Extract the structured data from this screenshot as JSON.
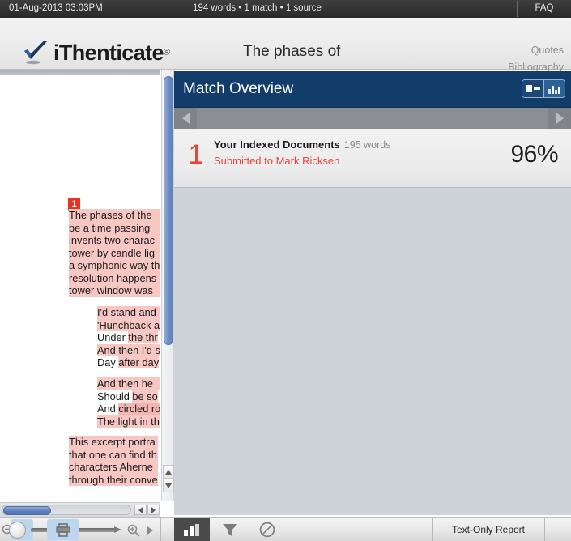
{
  "topbar": {
    "datetime": "01-Aug-2013 03:03PM",
    "stats": "194 words • 1 match • 1 source",
    "faq": "FAQ"
  },
  "header": {
    "logo_text": "iThenticate",
    "logo_registered": "®",
    "logo_icon": "blue-checkmark-icon",
    "document_title": "The phases of",
    "links": [
      {
        "label": "Quotes"
      },
      {
        "label": "Bibliography"
      }
    ]
  },
  "document": {
    "match_badge": "1",
    "paragraphs": [
      {
        "lines": [
          {
            "text": "The phases of the",
            "highlight": "full"
          },
          {
            "text": "be a time passing",
            "highlight": "full"
          },
          {
            "text": "invents two charac",
            "highlight": "full"
          },
          {
            "text": "tower by candle lig",
            "highlight": "full"
          },
          {
            "text": "a symphonic way th",
            "highlight": "full"
          },
          {
            "text": "resolution happens",
            "highlight": "full"
          },
          {
            "text": "tower window was",
            "highlight": "full"
          }
        ]
      },
      {
        "lines": [
          {
            "text": "I'd stand and",
            "highlight": "full"
          },
          {
            "text": "'Hunchback a",
            "highlight": "full"
          },
          {
            "text": "Under the thr",
            "highlight": "partial",
            "plain": "Under ",
            "marked": "the thr"
          },
          {
            "text": "And then I'd s",
            "highlight": "full"
          },
          {
            "text": "Day after day",
            "highlight": "partial",
            "plain": "Day ",
            "marked": "after day"
          }
        ]
      },
      {
        "lines": [
          {
            "text": "And then he",
            "highlight": "full"
          },
          {
            "text": "Should be so",
            "highlight": "partial",
            "plain": "Should ",
            "marked": "be so"
          },
          {
            "text": "And circled ro",
            "highlight": "partial",
            "plain": "And ",
            "marked": "circled ro"
          },
          {
            "text": "The light in th",
            "highlight": "full"
          }
        ]
      },
      {
        "lines": [
          {
            "text": "This excerpt portra",
            "highlight": "full"
          },
          {
            "text": "that one can find th",
            "highlight": "full"
          },
          {
            "text": "characters Aherne",
            "highlight": "full"
          },
          {
            "text": "through their conve",
            "highlight": "full"
          }
        ]
      }
    ]
  },
  "match_overview": {
    "title": "Match Overview",
    "view_toggles": [
      {
        "icon": "text-list-view-icon",
        "active": false
      },
      {
        "icon": "bar-chart-view-icon",
        "active": true
      }
    ],
    "nav": {
      "prev_icon": "chevron-left-icon",
      "next_icon": "chevron-right-icon"
    },
    "matches": [
      {
        "rank": "1",
        "source": "Your Indexed Documents",
        "words": "195 words",
        "submitted_to": "Submitted to Mark Ricksen",
        "percent": "96%"
      }
    ]
  },
  "bottom_toolbar": {
    "zoom_out_icon": "zoom-out-icon",
    "zoom_in_icon": "zoom-in-icon",
    "print_icon": "printer-icon",
    "expand_icon": "chevron-right-icon",
    "tools": [
      {
        "icon": "bar-chart-icon",
        "active": true
      },
      {
        "icon": "filter-funnel-icon",
        "active": false
      },
      {
        "icon": "exclude-circle-slash-icon",
        "active": false
      }
    ],
    "report_label": "Text-Only Report"
  },
  "colors": {
    "panel_header": "#123c69",
    "accent_red": "#e8443a",
    "highlight": "#f7c7c4",
    "highlight_strong": "#f2b5b1",
    "panel_body": "#ced3da"
  }
}
